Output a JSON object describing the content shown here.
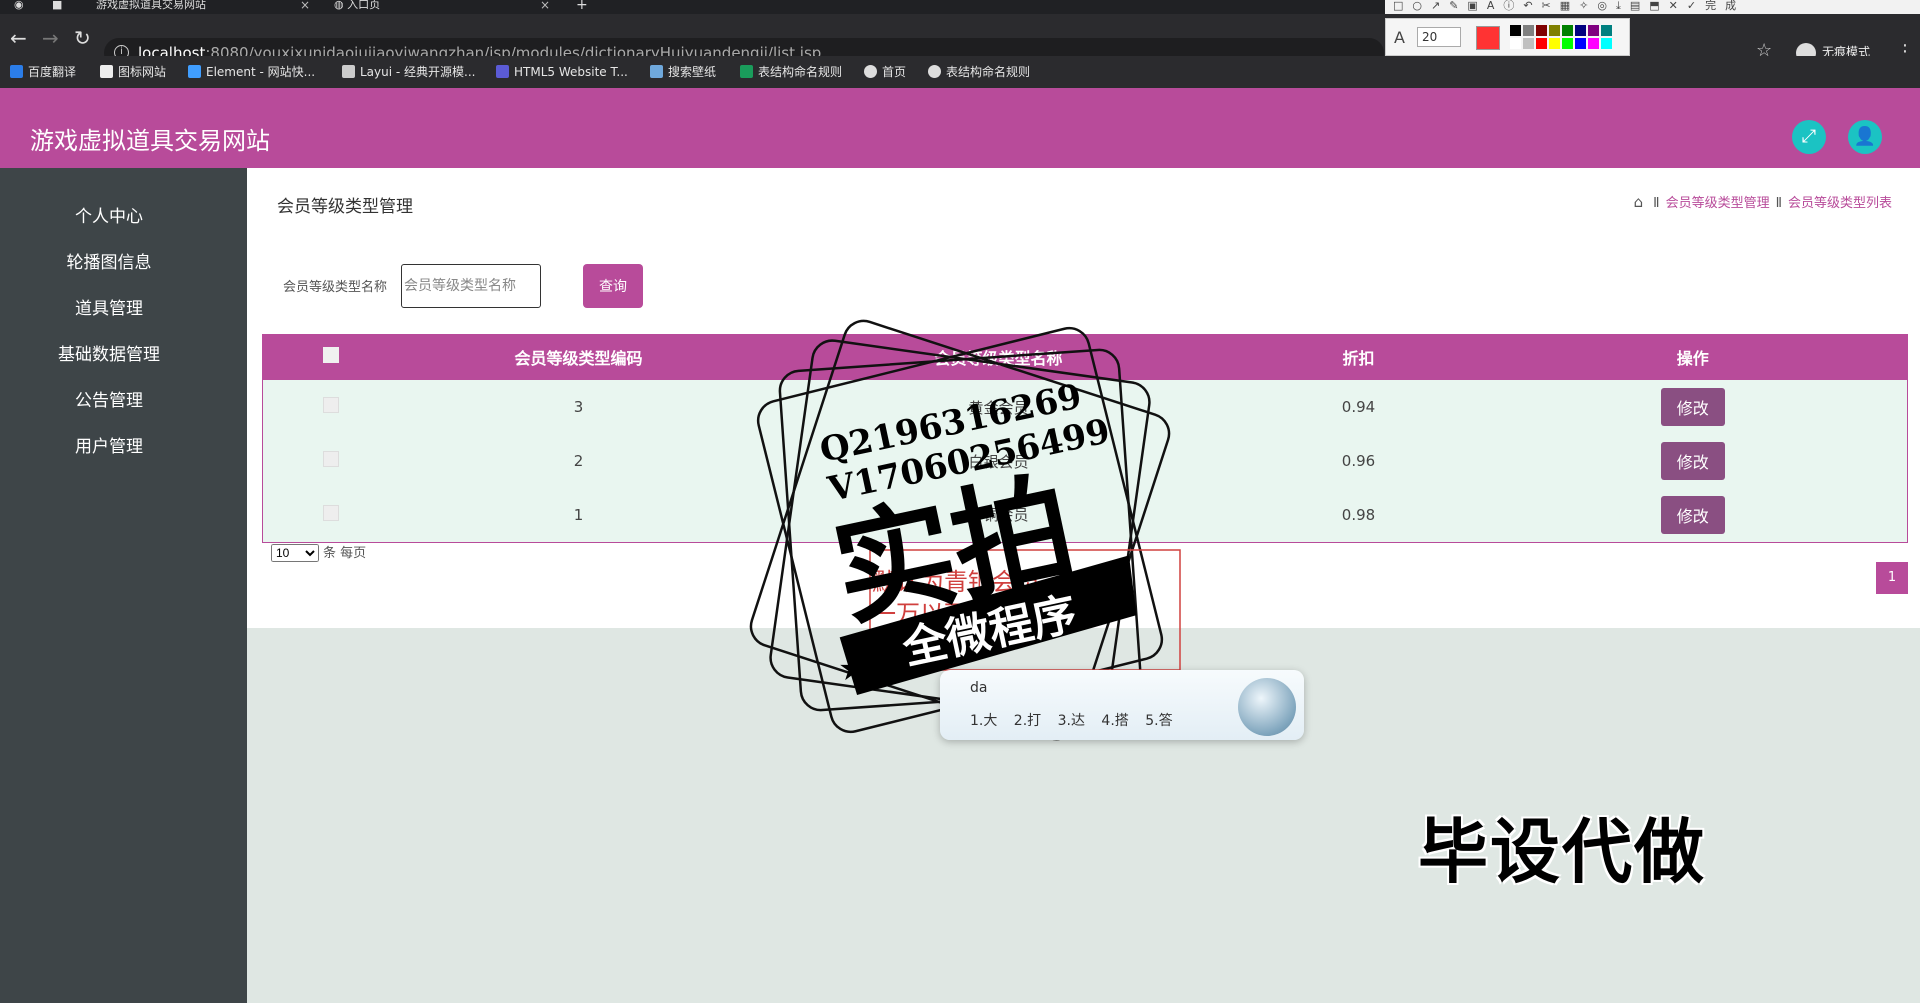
{
  "browser": {
    "tabs": [
      {
        "title": "游戏虚拟道具交易网站"
      },
      {
        "title": "入口页"
      }
    ],
    "new_tab": "+",
    "url_host": "localhost",
    "url_path": ":8080/youxixunidaojujiaoyiwangzhan/jsp/modules/dictionaryHuiyuandengji/list.jsp",
    "incognito_label": "无痕模式",
    "bookmarks": [
      {
        "label": "百度翻译",
        "color": "#2b7de9"
      },
      {
        "label": "图标网站",
        "color": "#eeeeee"
      },
      {
        "label": "Element - 网站快...",
        "color": "#409eff"
      },
      {
        "label": "Layui - 经典开源模...",
        "color": "#cccccc"
      },
      {
        "label": "HTML5 Website T...",
        "color": "#5b5bd6"
      },
      {
        "label": "搜索壁纸",
        "color": "#6fa8dc"
      },
      {
        "label": "表结构命名规则",
        "color": "#1a9c5b"
      },
      {
        "label": "首页",
        "color": "#dddddd"
      },
      {
        "label": "表结构命名规则",
        "color": "#dddddd"
      }
    ]
  },
  "screenshot_tool": {
    "font_size": "20",
    "current_color": "#ff3333",
    "swatches": [
      "#000000",
      "#808080",
      "#800000",
      "#808000",
      "#008000",
      "#000080",
      "#800080",
      "#008080",
      "#ffffff",
      "#c0c0c0",
      "#ff0000",
      "#ffff00",
      "#00ff00",
      "#0000ff",
      "#ff00ff",
      "#00ffff"
    ]
  },
  "app": {
    "title": "游戏虚拟道具交易网站",
    "accent": "#b84b9a",
    "sidebar": [
      {
        "label": "个人中心"
      },
      {
        "label": "轮播图信息"
      },
      {
        "label": "道具管理"
      },
      {
        "label": "基础数据管理"
      },
      {
        "label": "公告管理"
      },
      {
        "label": "用户管理"
      }
    ]
  },
  "page": {
    "title": "会员等级类型管理",
    "breadcrumb": [
      "会员等级类型管理",
      "会员等级类型列表"
    ],
    "breadcrumb_sep": "Ⅱ",
    "search": {
      "label": "会员等级类型名称",
      "placeholder": "会员等级类型名称",
      "button": "查询"
    },
    "table": {
      "headers": [
        "会员等级类型编码",
        "会员等级类型名称",
        "折扣",
        "操作"
      ],
      "rows": [
        {
          "code": "3",
          "name": "黄金会员",
          "discount": "0.94",
          "action": "修改"
        },
        {
          "code": "2",
          "name": "白银会员",
          "discount": "0.96",
          "action": "修改"
        },
        {
          "code": "1",
          "name": "青铜会员",
          "discount": "0.98",
          "action": "修改"
        }
      ]
    },
    "page_size": "10",
    "page_size_suffix": "条 每页",
    "current_page": "1"
  },
  "overlays": {
    "stamp_line1": "Q2196316269",
    "stamp_line2": "V17060256499",
    "stamp_main": "实拍",
    "stamp_banner": "全微程序",
    "handwritten_note_1": "默认为青铜会员",
    "handwritten_note_2": "一万以下青铜会员",
    "ime_typed": "da",
    "ime_candidates": "1.大 2.打 3.达 4.搭 5.答",
    "big_text": "毕设代做"
  }
}
